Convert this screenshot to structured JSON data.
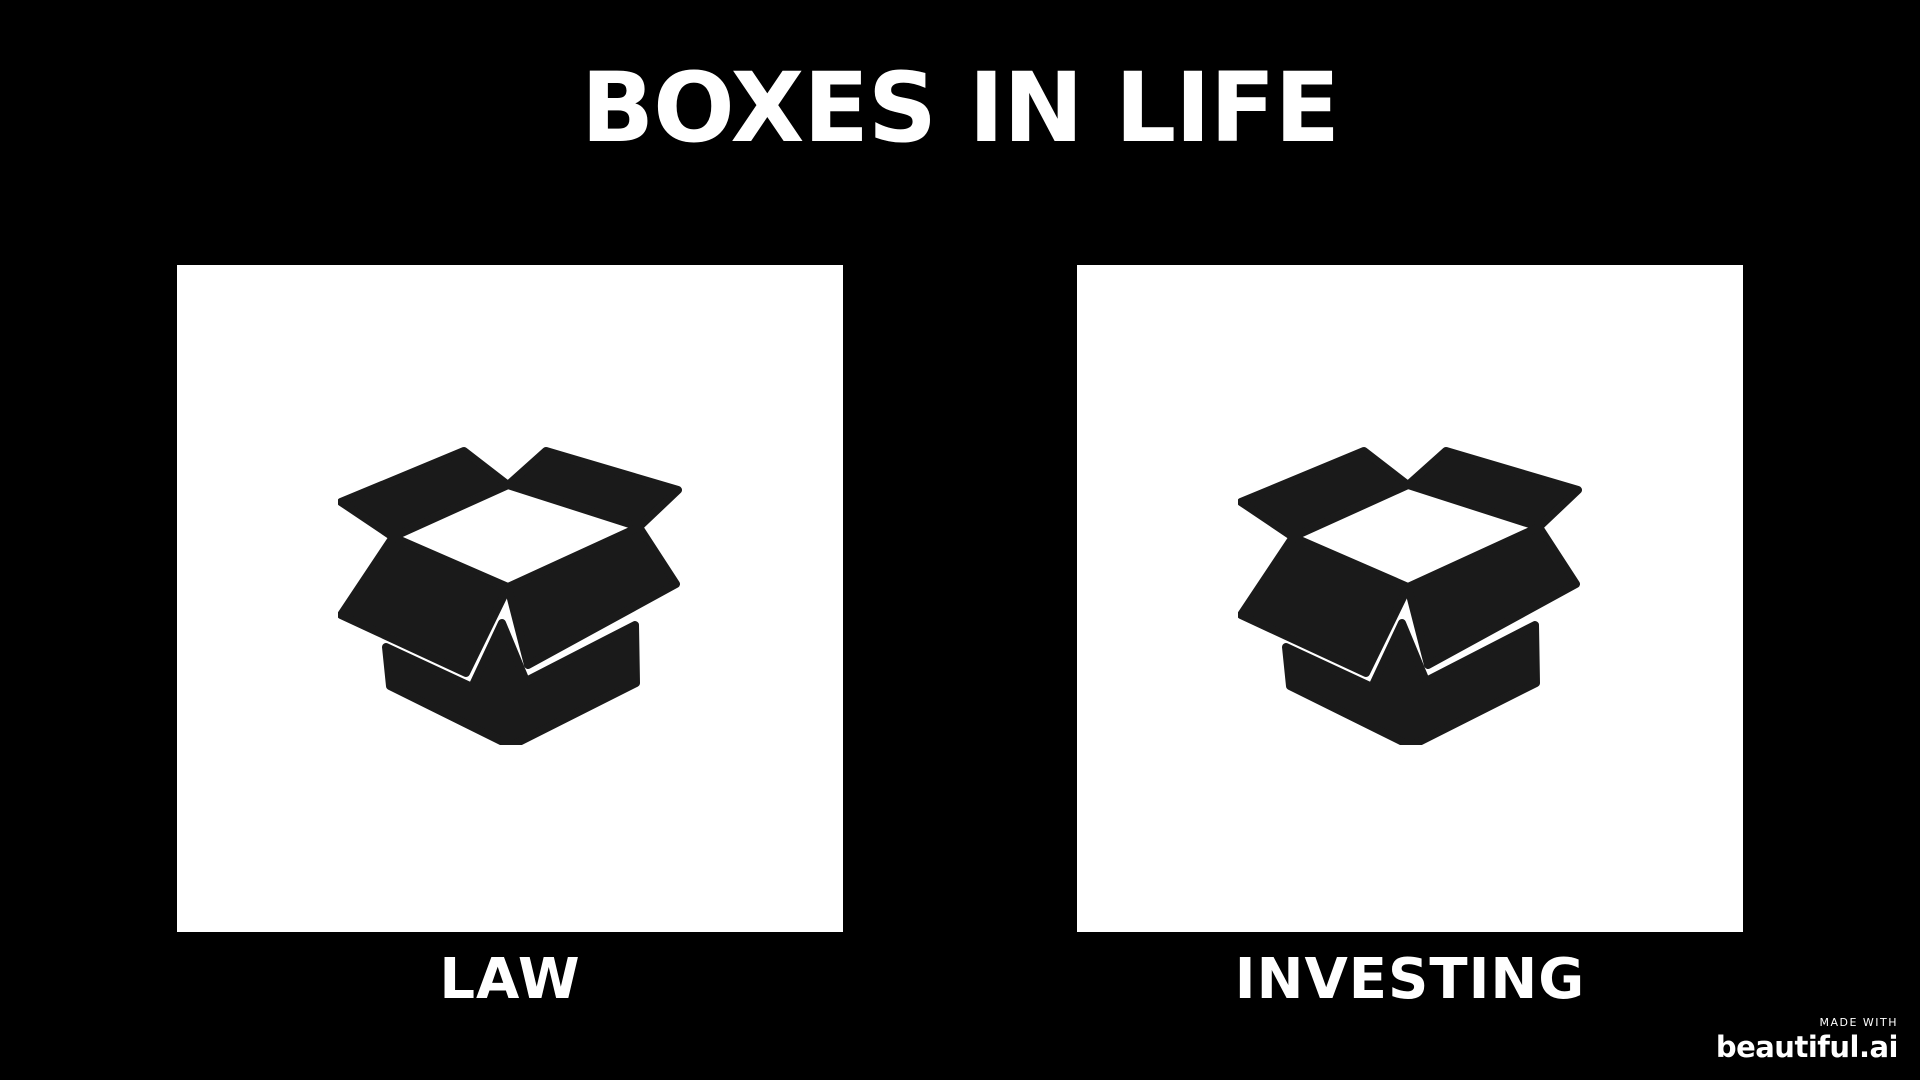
{
  "slide": {
    "title": "BOXES IN LIFE",
    "background_color": "#000000"
  },
  "cards": [
    {
      "label": "LAW",
      "icon": "open-box-icon",
      "card_color": "#ffffff",
      "icon_color": "#1a1a1a"
    },
    {
      "label": "INVESTING",
      "icon": "open-box-icon",
      "card_color": "#ffffff",
      "icon_color": "#1a1a1a"
    }
  ],
  "watermark": {
    "made_with": "MADE WITH",
    "brand": "beautiful.ai"
  }
}
